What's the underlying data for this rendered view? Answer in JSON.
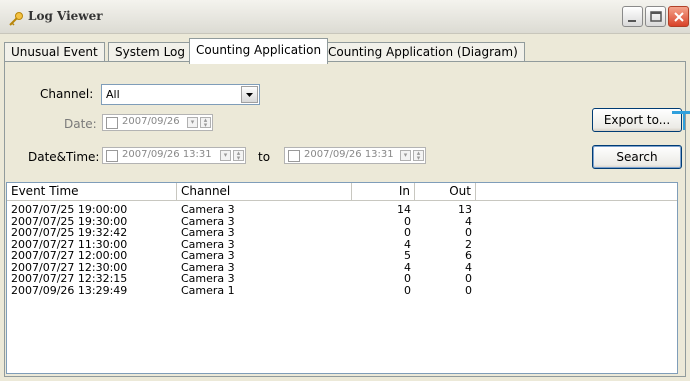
{
  "window": {
    "title": "Log Viewer",
    "title_icon": "key-icon"
  },
  "tabs": [
    {
      "label": "Unusual Event",
      "active": false
    },
    {
      "label": "System Log",
      "active": false
    },
    {
      "label": "Counting Application",
      "active": true
    },
    {
      "label": "Counting Application (Diagram)",
      "active": false
    }
  ],
  "filters": {
    "channel_label": "Channel:",
    "channel_value": "All",
    "date_label": "Date:",
    "date_value": "2007/09/26",
    "datetime_label": "Date&Time:",
    "datetime_from": "2007/09/26 13:31",
    "to_label": "to",
    "datetime_to": "2007/09/26 13:31"
  },
  "buttons": {
    "export_label": "Export to...",
    "search_label": "Search"
  },
  "table": {
    "columns": [
      "Event Time",
      "Channel",
      "In",
      "Out"
    ],
    "rows": [
      {
        "time": "2007/07/25 19:00:00",
        "channel": "Camera 3",
        "in": "14",
        "out": "13"
      },
      {
        "time": "2007/07/25 19:30:00",
        "channel": "Camera 3",
        "in": "0",
        "out": "4"
      },
      {
        "time": "2007/07/25 19:32:42",
        "channel": "Camera 3",
        "in": "0",
        "out": "0"
      },
      {
        "time": "2007/07/27 11:30:00",
        "channel": "Camera 3",
        "in": "4",
        "out": "2"
      },
      {
        "time": "2007/07/27 12:00:00",
        "channel": "Camera 3",
        "in": "5",
        "out": "6"
      },
      {
        "time": "2007/07/27 12:30:00",
        "channel": "Camera 3",
        "in": "4",
        "out": "4"
      },
      {
        "time": "2007/07/27 12:32:15",
        "channel": "Camera 3",
        "in": "0",
        "out": "0"
      },
      {
        "time": "2007/09/26 13:29:49",
        "channel": "Camera 1",
        "in": "0",
        "out": "0"
      }
    ]
  },
  "colors": {
    "close_button": "#d9432a",
    "accent_line": "#2fa0dc"
  }
}
